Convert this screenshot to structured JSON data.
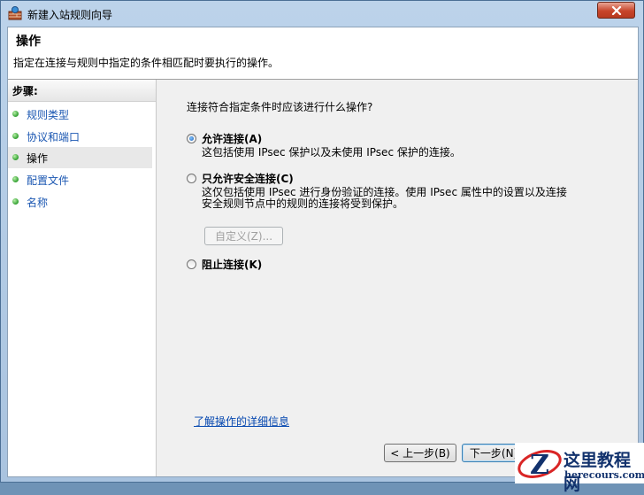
{
  "window": {
    "title": "新建入站规则向导",
    "close_icon": "close-icon",
    "title_icon": "firewall-icon"
  },
  "header": {
    "title": "操作",
    "subtitle": "指定在连接与规则中指定的条件相匹配时要执行的操作。"
  },
  "steps": {
    "heading": "步骤:",
    "items": [
      {
        "label": "规则类型",
        "active": false
      },
      {
        "label": "协议和端口",
        "active": false
      },
      {
        "label": "操作",
        "active": true
      },
      {
        "label": "配置文件",
        "active": false
      },
      {
        "label": "名称",
        "active": false
      }
    ]
  },
  "main": {
    "question": "连接符合指定条件时应该进行什么操作?",
    "options": [
      {
        "label": "允许连接(A)",
        "desc": "这包括使用 IPsec 保护以及未使用 IPsec 保护的连接。",
        "checked": true
      },
      {
        "label": "只允许安全连接(C)",
        "desc": "这仅包括使用 IPsec 进行身份验证的连接。使用 IPsec 属性中的设置以及连接安全规则节点中的规则的连接将受到保护。",
        "checked": false
      },
      {
        "label": "阻止连接(K)",
        "desc": "",
        "checked": false
      }
    ],
    "customize_button": "自定义(Z)...",
    "learn_more_link": "了解操作的详细信息"
  },
  "footer": {
    "back_button": "< 上一步(B)",
    "next_button": "下一步(N) >"
  },
  "watermark": {
    "text_cn": "这里教程网",
    "text_en": "herecours.com",
    "logo_letter": "Z"
  },
  "colors": {
    "link": "#0648b0",
    "step_bullet": "#2f9e2f",
    "close_button": "#c7452b"
  }
}
